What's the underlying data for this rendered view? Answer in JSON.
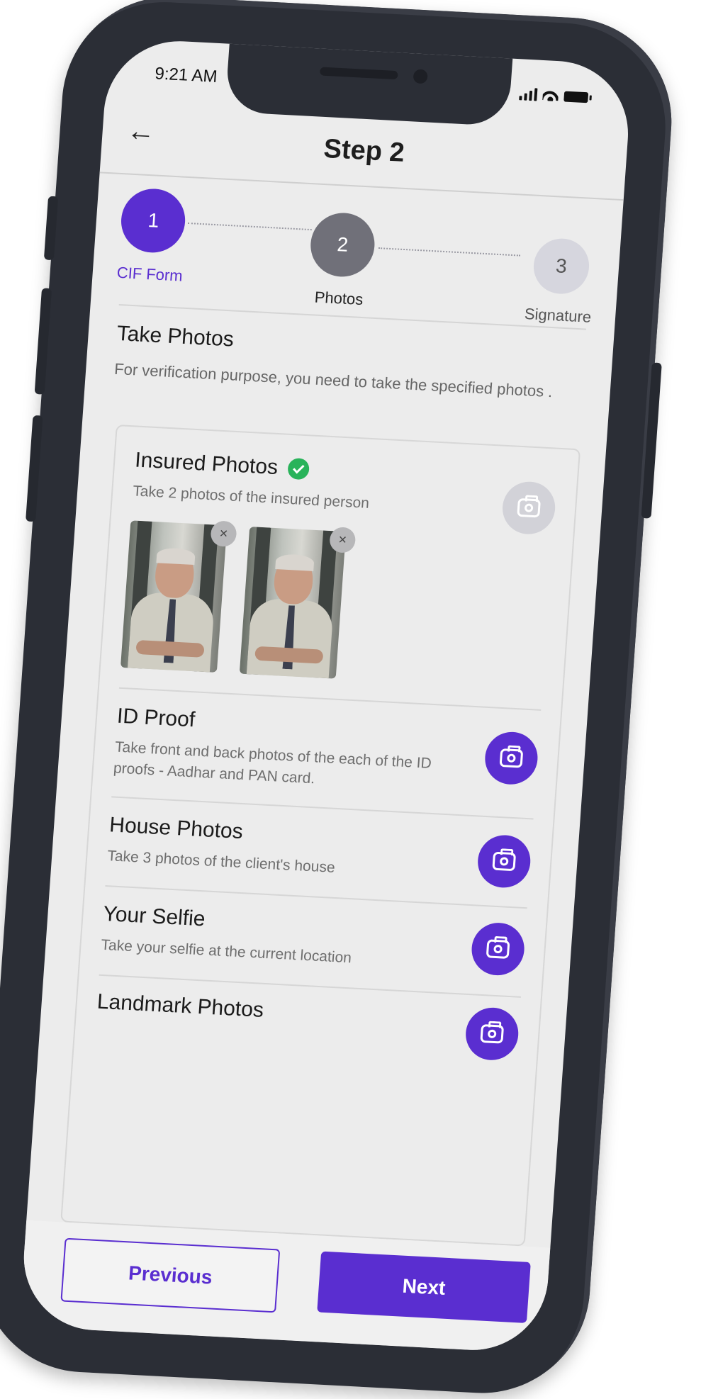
{
  "status_bar": {
    "time": "9:21 AM"
  },
  "header": {
    "title": "Step 2"
  },
  "stepper": {
    "steps": [
      {
        "number": "1",
        "label": "CIF Form"
      },
      {
        "number": "2",
        "label": "Photos"
      },
      {
        "number": "3",
        "label": "Signature"
      }
    ]
  },
  "intro": {
    "title": "Take Photos",
    "description": "For verification purpose, you need to take the specified photos ."
  },
  "sections": [
    {
      "title": "Insured Photos",
      "description": "Take 2 photos of the insured person",
      "complete": true
    },
    {
      "title": "ID Proof",
      "description": "Take front and back photos of the each of the ID proofs - Aadhar and PAN card."
    },
    {
      "title": "House Photos",
      "description": "Take 3 photos of the client's house"
    },
    {
      "title": "Your Selfie",
      "description": "Take your selfie at the current location"
    },
    {
      "title": "Landmark Photos"
    }
  ],
  "thumbnails": {
    "remove_glyph": "×"
  },
  "footer": {
    "previous_label": "Previous",
    "next_label": "Next"
  },
  "colors": {
    "accent": "#5a2ed0",
    "success": "#29b35a",
    "phone_frame": "#2b2e36"
  },
  "icons": {
    "back": "back-arrow-icon",
    "camera": "camera-icon",
    "check": "check-circle-icon",
    "close": "close-icon"
  }
}
